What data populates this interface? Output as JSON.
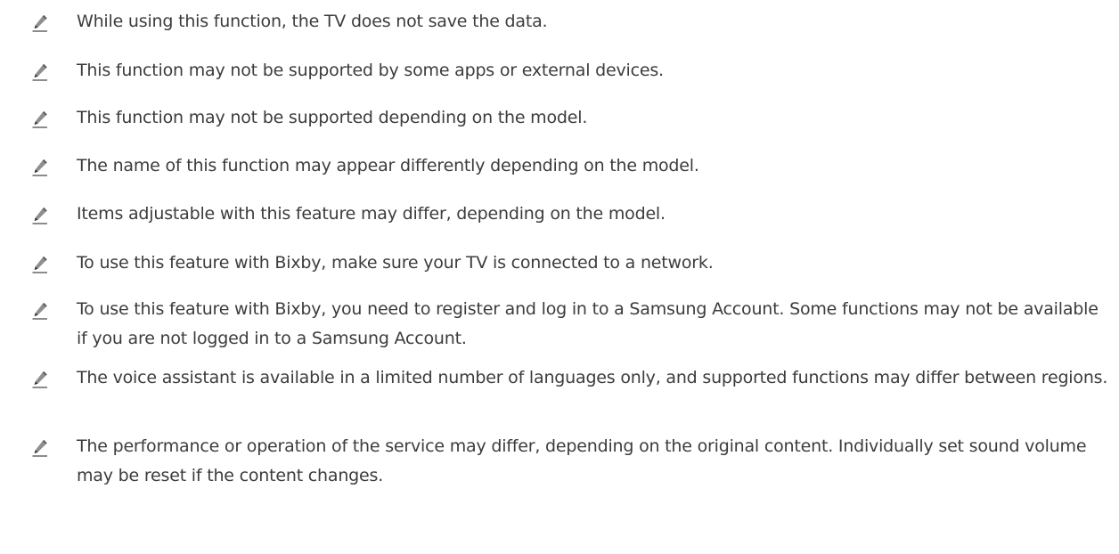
{
  "notes": [
    {
      "icon": "pencil-note-icon",
      "text": "While using this function, the TV does not save the data."
    },
    {
      "icon": "pencil-note-icon",
      "text": "This function may not be supported by some apps or external devices."
    },
    {
      "icon": "pencil-note-icon",
      "text": "This function may not be supported depending on the model."
    },
    {
      "icon": "pencil-note-icon",
      "text": "The name of this function may appear differently depending on the model."
    },
    {
      "icon": "pencil-note-icon",
      "text": "Items adjustable with this feature may differ, depending on the model."
    },
    {
      "icon": "pencil-note-icon",
      "text": "To use this feature with Bixby, make sure your TV is connected to a network."
    },
    {
      "icon": "pencil-note-icon",
      "text": "To use this feature with Bixby, you need to register and log in to a Samsung Account. Some functions may not be available if you are not logged in to a Samsung Account."
    },
    {
      "icon": "pencil-note-icon",
      "text": "The voice assistant is available in a limited number of languages only, and supported functions may differ between regions."
    },
    {
      "icon": "pencil-note-icon",
      "text": "The performance or operation of the service may differ, depending on the original content. Individually set sound volume may be reset if the content changes."
    }
  ]
}
